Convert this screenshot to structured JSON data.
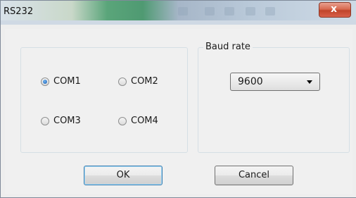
{
  "window": {
    "title": "RS232"
  },
  "titlebar": {
    "close_icon": "close-icon",
    "close_glyph": "x"
  },
  "ports": {
    "options": [
      "COM1",
      "COM2",
      "COM3",
      "COM4"
    ],
    "selected": "COM1"
  },
  "baud": {
    "group_label": "Baud rate",
    "selected_value": "9600"
  },
  "buttons": {
    "ok_label": "OK",
    "cancel_label": "Cancel"
  }
}
